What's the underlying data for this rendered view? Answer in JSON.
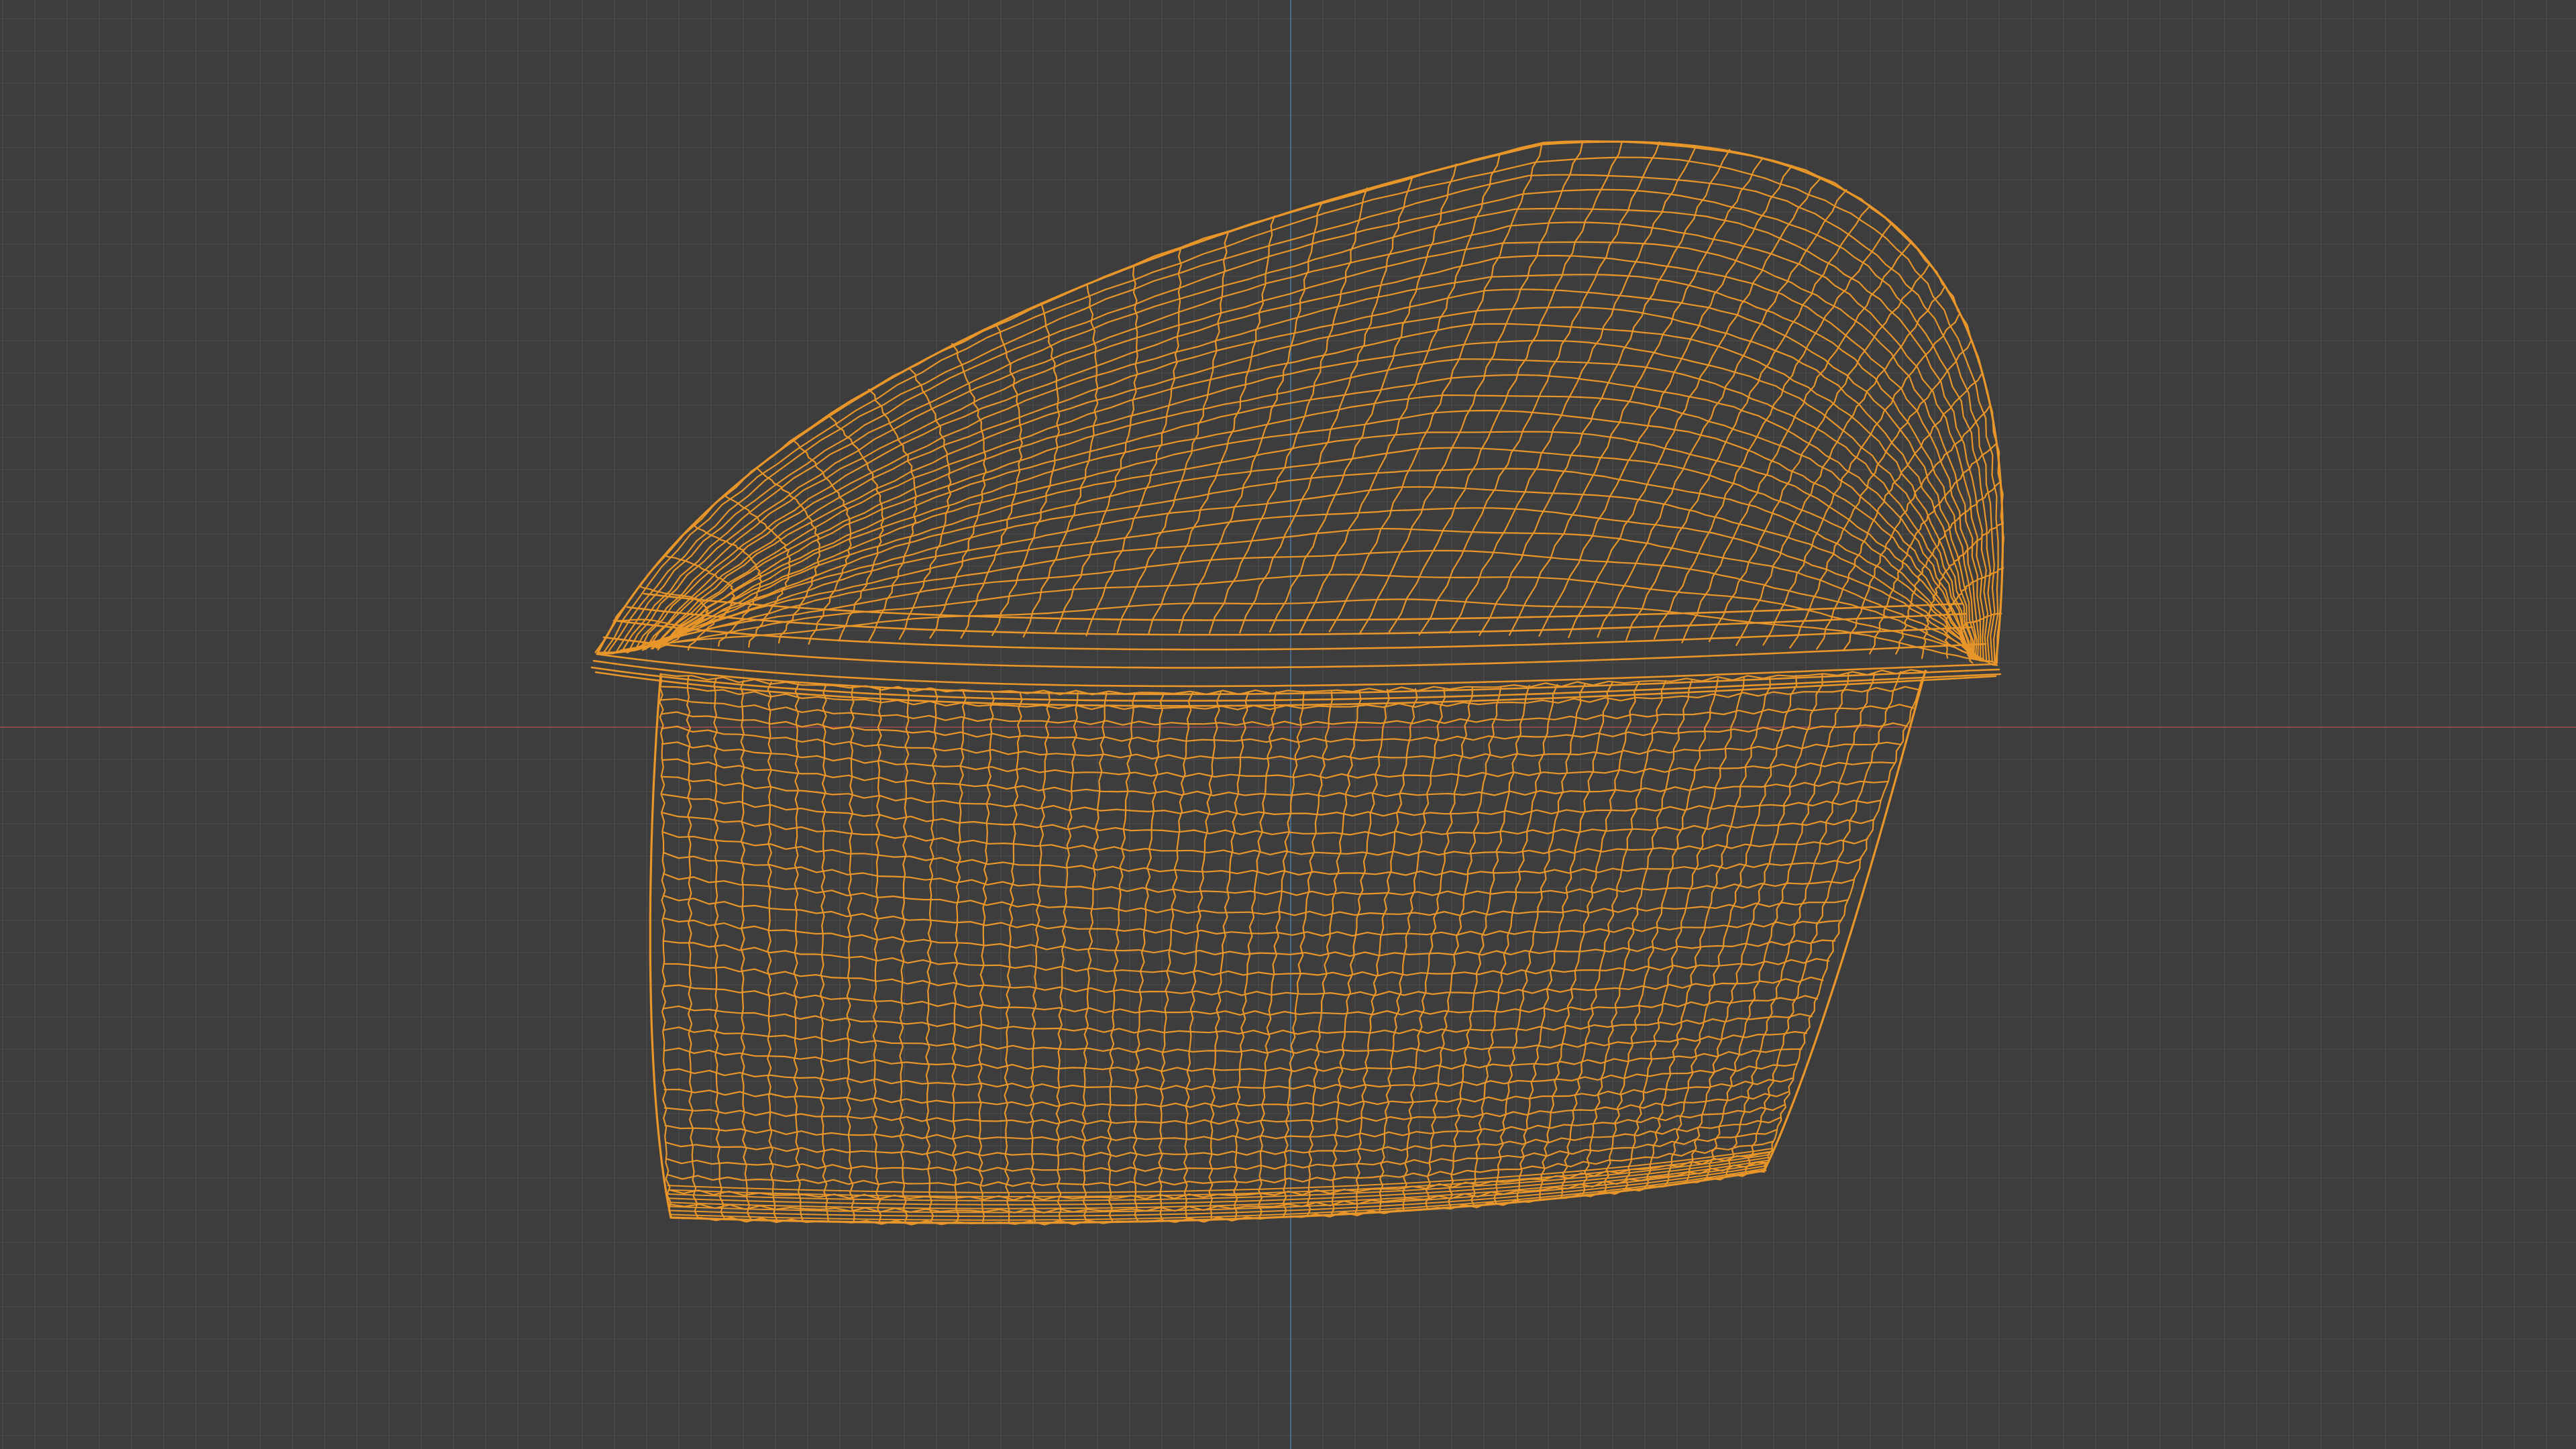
{
  "viewport": {
    "view": "orthographic-front",
    "shading": "wireframe",
    "background_color": "#3d3d3d",
    "grid_color": "#4a4a4a",
    "grid_major_color": "#545454",
    "x_axis_color": "#8a4a4a",
    "z_axis_color": "#4a6a8a"
  },
  "mesh": {
    "name_icon": "bread-loaf-mesh",
    "wire_color": "#e8962a",
    "selected": true
  }
}
